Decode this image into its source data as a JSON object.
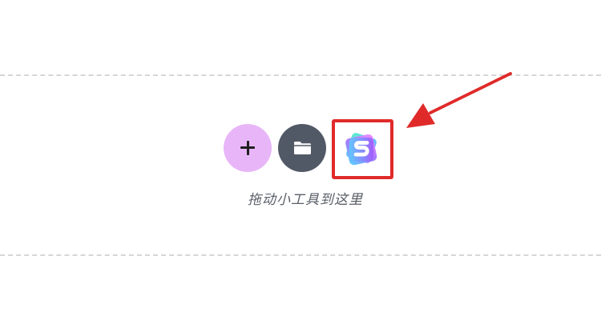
{
  "page": {
    "background": "#ffffff"
  },
  "drop_zone": {
    "hint_text": "拖动小工具到这里",
    "line_color": "#d6d6d6"
  },
  "widgets": {
    "add_button": {
      "icon": "plus-icon",
      "color": "#e8b6f8"
    },
    "folder_button": {
      "icon": "folder-icon",
      "color": "#525966"
    },
    "s_widget": {
      "icon": "s-logo-icon",
      "highlighted": true,
      "highlight_color": "#e02a2a"
    }
  },
  "annotation": {
    "arrow_color": "#e02a2a"
  }
}
